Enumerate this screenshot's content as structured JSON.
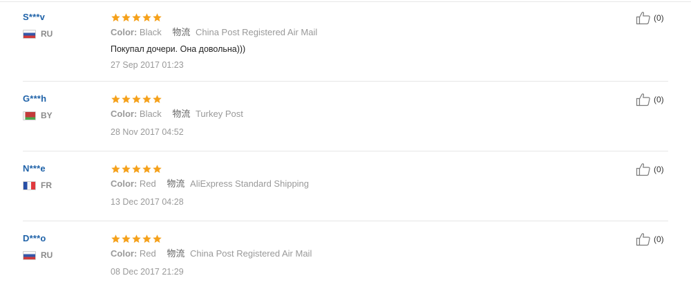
{
  "accent_star": "#f5a11b",
  "username_color": "#1f62a8",
  "reviews": [
    {
      "user": "S***v",
      "flag": "ru",
      "country": "RU",
      "color_label": "Color:",
      "color_value": "Black",
      "logistics_label": "物流",
      "logistics_value": "China Post Registered Air Mail",
      "comment": "Покупал дочери. Она довольна)))",
      "date": "27 Sep 2017 01:23",
      "helpful": "(0)",
      "stars": 5
    },
    {
      "user": "G***h",
      "flag": "by",
      "country": "BY",
      "color_label": "Color:",
      "color_value": "Black",
      "logistics_label": "物流",
      "logistics_value": "Turkey Post",
      "comment": "",
      "date": "28 Nov 2017 04:52",
      "helpful": "(0)",
      "stars": 5
    },
    {
      "user": "N***e",
      "flag": "fr",
      "country": "FR",
      "color_label": "Color:",
      "color_value": "Red",
      "logistics_label": "物流",
      "logistics_value": "AliExpress Standard Shipping",
      "comment": "",
      "date": "13 Dec 2017 04:28",
      "helpful": "(0)",
      "stars": 5
    },
    {
      "user": "D***o",
      "flag": "ru",
      "country": "RU",
      "color_label": "Color:",
      "color_value": "Red",
      "logistics_label": "物流",
      "logistics_value": "China Post Registered Air Mail",
      "comment": "",
      "date": "08 Dec 2017 21:29",
      "helpful": "(0)",
      "stars": 5
    }
  ]
}
